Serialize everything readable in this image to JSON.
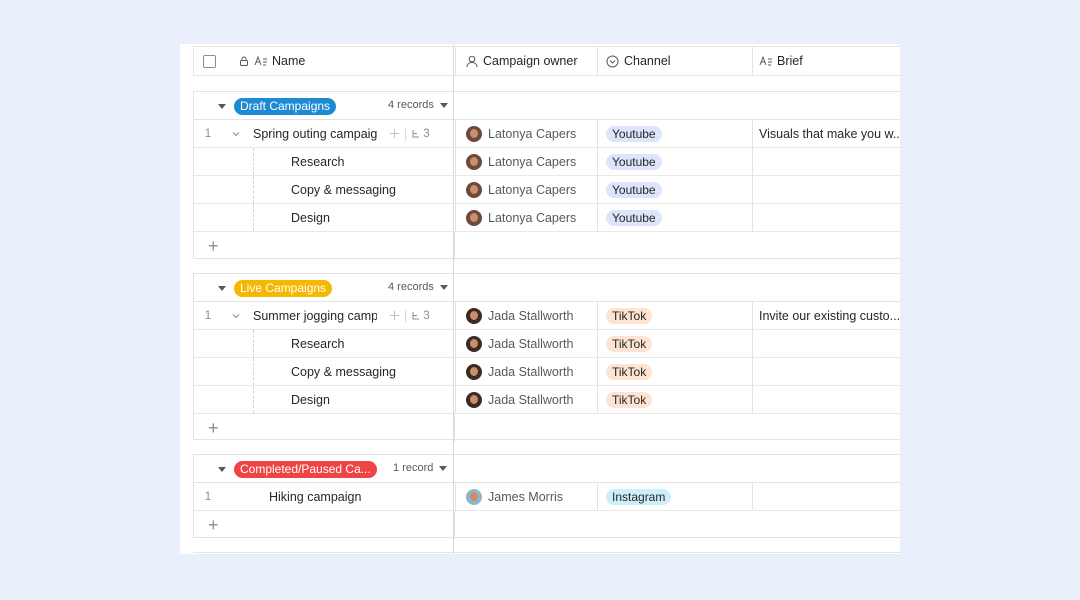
{
  "header": {
    "name": "Name",
    "owner": "Campaign owner",
    "channel": "Channel",
    "brief": "Brief"
  },
  "groups": [
    {
      "label": "Draft Campaigns",
      "color": "#1c8bd4",
      "count": "4 records",
      "rows": [
        {
          "num": "1",
          "name": "Spring outing campaign",
          "owner": "Latonya Capers",
          "channel": "Youtube",
          "brief": "Visuals that make you w...",
          "subcount": "3"
        },
        {
          "name": "Research",
          "owner": "Latonya Capers",
          "channel": "Youtube"
        },
        {
          "name": "Copy & messaging",
          "owner": "Latonya Capers",
          "channel": "Youtube"
        },
        {
          "name": "Design",
          "owner": "Latonya Capers",
          "channel": "Youtube"
        }
      ]
    },
    {
      "label": "Live Campaigns",
      "color": "#f5b800",
      "count": "4 records",
      "rows": [
        {
          "num": "1",
          "name": "Summer jogging campaign",
          "owner": "Jada Stallworth",
          "channel": "TikTok",
          "brief": "Invite our existing custo...",
          "subcount": "3"
        },
        {
          "name": "Research",
          "owner": "Jada Stallworth",
          "channel": "TikTok"
        },
        {
          "name": "Copy & messaging",
          "owner": "Jada Stallworth",
          "channel": "TikTok"
        },
        {
          "name": "Design",
          "owner": "Jada Stallworth",
          "channel": "TikTok"
        }
      ]
    },
    {
      "label": "Completed/Paused Ca...",
      "color": "#ef4444",
      "count": "1 record",
      "rows": [
        {
          "num": "1",
          "name": "Hiking campaign",
          "owner": "James Morris",
          "channel": "Instagram"
        }
      ]
    }
  ],
  "colors": {
    "youtube_bg": "#dde5fb",
    "tiktok_bg": "#fde3d1",
    "instagram_bg": "#cdeffb"
  }
}
